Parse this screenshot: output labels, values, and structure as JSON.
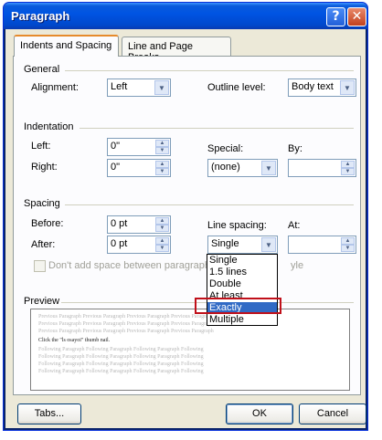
{
  "window": {
    "title": "Paragraph",
    "help_label": "?",
    "close_label": "✕"
  },
  "tabs": [
    {
      "label": "Indents and Spacing"
    },
    {
      "label": "Line and Page Breaks"
    }
  ],
  "general": {
    "heading": "General",
    "alignment_label": "Alignment:",
    "alignment_value": "Left",
    "outline_label": "Outline level:",
    "outline_value": "Body text"
  },
  "indentation": {
    "heading": "Indentation",
    "left_label": "Left:",
    "left_value": "0\"",
    "right_label": "Right:",
    "right_value": "0\"",
    "special_label": "Special:",
    "special_value": "(none)",
    "by_label": "By:",
    "by_value": ""
  },
  "spacing": {
    "heading": "Spacing",
    "before_label": "Before:",
    "before_value": "0 pt",
    "after_label": "After:",
    "after_value": "0 pt",
    "line_spacing_label": "Line spacing:",
    "line_spacing_value": "Single",
    "at_label": "At:",
    "at_value": "",
    "dont_add_space_label": "Don't add space between paragraph",
    "dont_add_space_tail": "yle"
  },
  "line_spacing_options": [
    "Single",
    "1.5 lines",
    "Double",
    "At least",
    "Exactly",
    "Multiple"
  ],
  "line_spacing_highlighted": "Exactly",
  "preview": {
    "heading": "Preview",
    "lines_before": [
      "Previous Paragraph Previous Paragraph Previous Paragraph Previous Paragraph",
      "Previous Paragraph Previous Paragraph Previous Paragraph Previous Paragraph",
      "Previous Paragraph Previous Paragraph Previous Paragraph Previous Paragraph"
    ],
    "main_line": "Click the \"ls osayoi\" thumb nail.",
    "lines_after": [
      "Following Paragraph Following Paragraph Following Paragraph Following",
      "Following Paragraph Following Paragraph Following Paragraph Following",
      "Following Paragraph Following Paragraph Following Paragraph Following",
      "Following Paragraph Following Paragraph Following Paragraph Following"
    ]
  },
  "buttons": {
    "tabs": "Tabs...",
    "ok": "OK",
    "cancel": "Cancel"
  }
}
